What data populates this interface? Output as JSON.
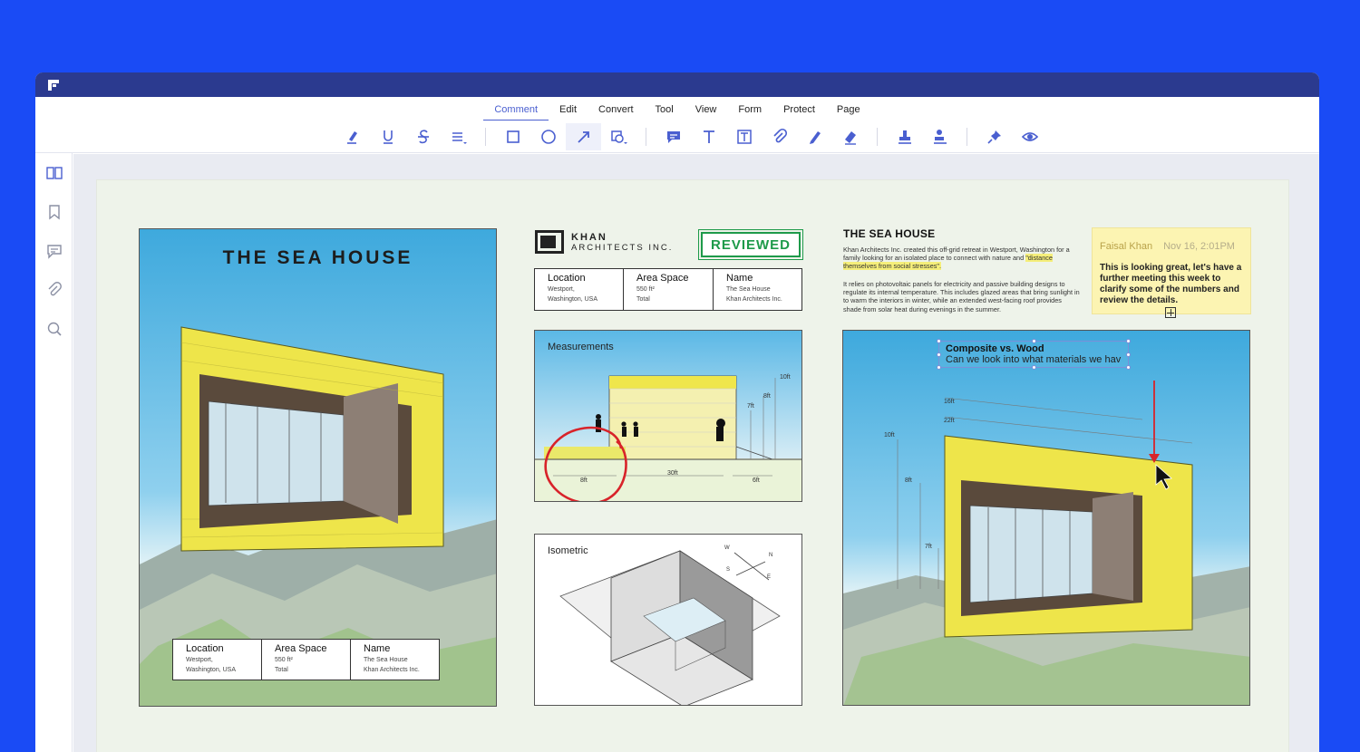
{
  "menu": {
    "tabs": [
      {
        "label": "Comment",
        "active": true
      },
      {
        "label": "Edit"
      },
      {
        "label": "Convert"
      },
      {
        "label": "Tool"
      },
      {
        "label": "View"
      },
      {
        "label": "Form"
      },
      {
        "label": "Protect"
      },
      {
        "label": "Page"
      }
    ]
  },
  "toolbar": {
    "icons": [
      "highlight-icon",
      "underline-icon",
      "strikethrough-icon",
      "text-list-icon",
      "rectangle-icon",
      "ellipse-icon",
      "arrow-icon",
      "shapes-icon",
      "comment-icon",
      "text-icon",
      "textbox-icon",
      "attachment-icon",
      "pencil-icon",
      "eraser-icon",
      "stamp-icon",
      "signature-stamp-icon",
      "pin-icon",
      "eye-icon"
    ]
  },
  "sidebar": {
    "icons": [
      "thumbnails-icon",
      "bookmark-icon",
      "comments-icon",
      "attachments-icon",
      "search-icon"
    ]
  },
  "colors": {
    "accent": "#4a5fd0",
    "titlebar": "#2b3a8f",
    "background": "#1a4bf5",
    "stamp": "#1e9a4a",
    "annotation_red": "#d8232a"
  },
  "document": {
    "poster": {
      "title": "THE SEA HOUSE",
      "table": [
        {
          "head": "Location",
          "sub1": "Westport,",
          "sub2": "Washington, USA"
        },
        {
          "head": "Area Space",
          "sub1": "550 ft²",
          "sub2": "Total"
        },
        {
          "head": "Name",
          "sub1": "The Sea House",
          "sub2": "Khan Architects Inc."
        }
      ]
    },
    "logo": {
      "name": "KHAN",
      "sub": "ARCHITECTS INC."
    },
    "stamp": "REVIEWED",
    "info_table": [
      {
        "head": "Location",
        "sub1": "Westport,",
        "sub2": "Washington, USA"
      },
      {
        "head": "Area Space",
        "sub1": "550 ft²",
        "sub2": "Total"
      },
      {
        "head": "Name",
        "sub1": "The Sea House",
        "sub2": "Khan Architects Inc."
      }
    ],
    "measurements": {
      "label": "Measurements",
      "dims": {
        "h10": "10ft",
        "h8": "8ft",
        "h7": "7ft",
        "w8": "8ft",
        "w30": "30ft",
        "w6": "6ft"
      }
    },
    "isometric": {
      "label": "Isometric",
      "compass": {
        "w": "W",
        "n": "N",
        "s": "S",
        "e": "E"
      }
    },
    "article": {
      "title": "THE SEA HOUSE",
      "p1_before": "Khan Architects Inc. created this off-grid retreat in Westport, Washington for a family looking for an isolated place to connect with nature and",
      "p1_highlight": "\"distance themselves from social stresses\".",
      "p2": "It relies on photovoltaic panels for electricity and passive building designs to regulate its internal temperature. This includes glazed areas that bring sunlight in to warm the interiors in winter, while an extended west-facing roof provides shade from solar heat during evenings in the summer."
    },
    "sticky_note": {
      "author": "Faisal Khan",
      "date": "Nov 16, 2:01PM",
      "body": "This is looking great, let's have a further meeting this week to clarify some of the numbers and review the details."
    },
    "text_annotation": {
      "title": "Composite vs. Wood",
      "body": "Can we look into what materials we hav"
    },
    "right_dims": {
      "d16": "16ft",
      "d22": "22ft",
      "d10": "10ft",
      "d8": "8ft",
      "d7": "7ft"
    }
  }
}
